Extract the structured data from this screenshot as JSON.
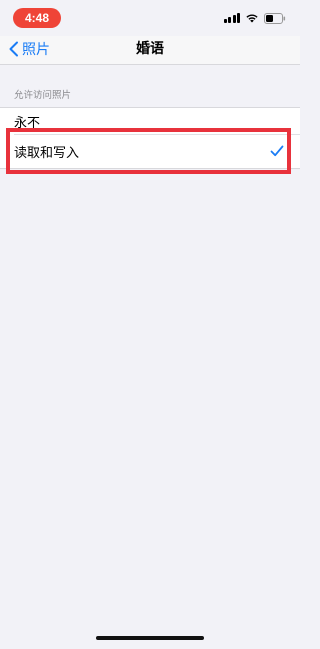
{
  "status_bar": {
    "time": "4:48",
    "time_pill_color": "#ef4437",
    "icons": [
      "cellular-signal-icon",
      "wifi-icon",
      "battery-icon"
    ]
  },
  "nav": {
    "back_label": "照片",
    "title": "婚语",
    "accent_color": "#1a7cf5"
  },
  "section": {
    "header": "允许访问照片",
    "options": [
      {
        "label": "永不",
        "selected": false
      },
      {
        "label": "读取和写入",
        "selected": true
      }
    ],
    "highlight_color": "#e8323c"
  }
}
